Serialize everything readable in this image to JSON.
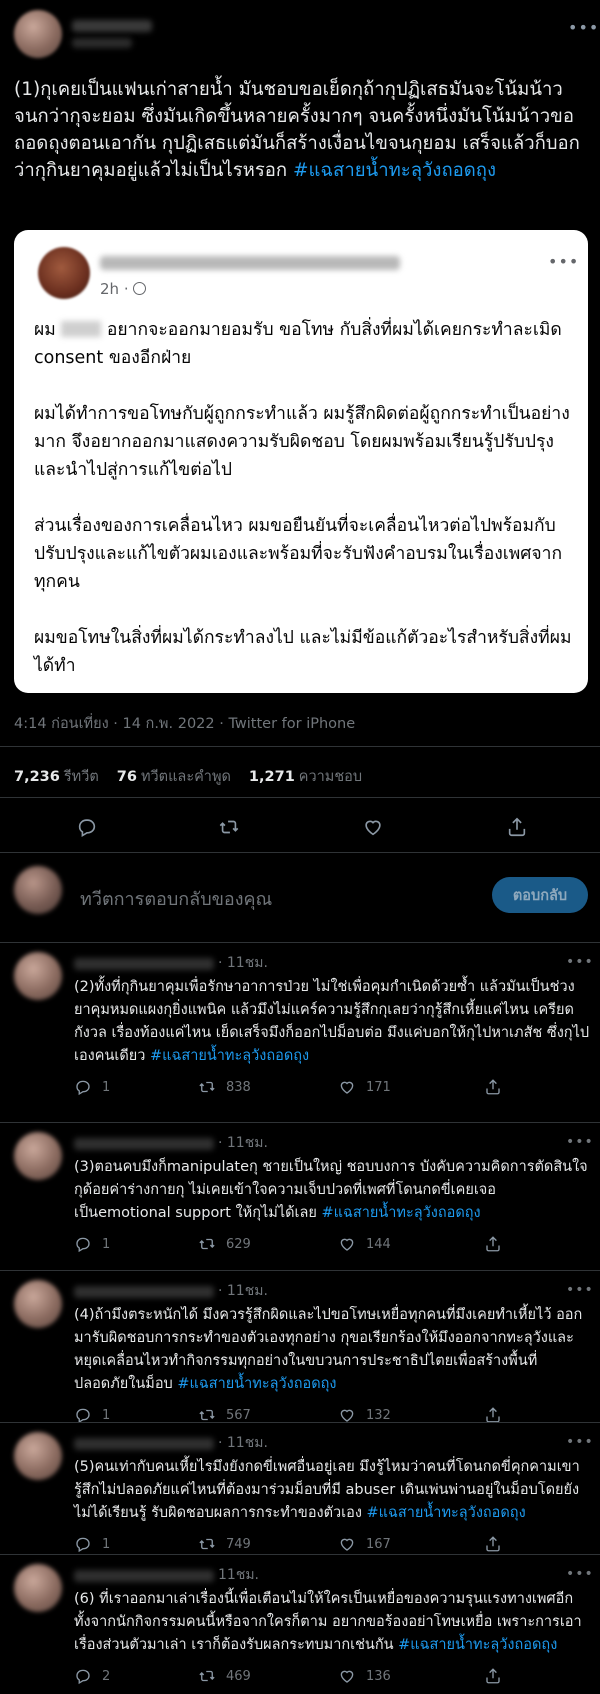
{
  "main_tweet": {
    "text": "(1)กุเคยเป็นแฟนเก่าสายน้ำ มันชอบขอเย็ดกุถ้ากุปฏิเสธมันจะโน้มน้าวจนกว่ากุจะยอม ซึ่งมันเกิดขึ้นหลายครั้งมากๆ จนครั้งหนึ่งมันโน้มน้าวขอถอดถุงตอนเอากัน กุปฏิเสธแต่มันก็สร้างเงื่อนไขจนกุยอม เสร็จแล้วก็บอกว่ากุกินยาคุมอยู่แล้วไม่เป็นไรหรอก ",
    "hashtag": "#แฉสายน้ำทะลุวังถอดถุง",
    "quote": {
      "time": "2h ·",
      "para1_a": "ผม ",
      "para1_b": " อยากจะออกมายอมรับ ขอโทษ กับสิ่งที่ผมได้เคยกระทำละเมิด consent ของอีกฝ่าย",
      "para2": "ผมได้ทำการขอโทษกับผู้ถูกกระทำแล้ว ผมรู้สึกผิดต่อผู้ถูกกระทำเป็นอย่างมาก จึงอยากออกมาแสดงความรับผิดชอบ โดยผมพร้อมเรียนรู้ปรับปรุง และนำไปสู่การแก้ไขต่อไป",
      "para3": "ส่วนเรื่องของการเคลื่อนไหว ผมขอยืนยันที่จะเคลื่อนไหวต่อไปพร้อมกับปรับปรุงและแก้ไขตัวผมเองและพร้อมที่จะรับฟังคำอบรมในเรื่องเพศจากทุกคน",
      "para4": "ผมขอโทษในสิ่งที่ผมได้กระทำลงไป และไม่มีข้อแก้ตัวอะไรสำหรับสิ่งที่ผมได้ทำ"
    },
    "meta": "4:14 ก่อนเที่ยง · 14 ก.พ. 2022 · Twitter for iPhone",
    "stats": {
      "retweets_count": "7,236",
      "retweets_label": "รีทวีต",
      "quotes_count": "76",
      "quotes_label": "ทวีตและคำพูด",
      "likes_count": "1,271",
      "likes_label": "ความชอบ"
    }
  },
  "reply_compose": {
    "placeholder": "ทวีตการตอบกลับของคุณ",
    "button_label": "ตอบกลับ"
  },
  "replies": [
    {
      "time": "· 11ชม.",
      "text": "(2)ทั้งที่กุกินยาคุมเพื่อรักษาอาการป่วย ไม่ใช่เพื่อคุมกำเนิดด้วยซ้ำ แล้วมันเป็นช่วงยาคุมหมดแผงกุยิ่งแพนิค แล้วมึงไม่แคร์ความรู้สึกกุเลยว่ากุรู้สึกเหี้ยแค่ไหน เครียด กังวล เรื่องท้องแค่ไหน เย็ดเสร็จมึงก็ออกไปม็อบต่อ มึงแค่บอกให้กุไปหาเภสัช ซึ่งกุไปเองคนเดียว ",
      "hashtag": "#แฉสายน้ำทะลุวังถอดถุง",
      "replies": "1",
      "retweets": "838",
      "likes": "171"
    },
    {
      "time": "· 11ชม.",
      "text": "(3)ตอนคบมึงก็manipulateกุ ชายเป็นใหญ่ ชอบบงการ บังคับความคิดการตัดสินใจกุด้อยค่าร่างกายกุ ไม่เคยเข้าใจความเจ็บปวดที่เพศที่โดนกดขี่เคยเจอ เป็นemotional support ให้กุไม่ได้เลย ",
      "hashtag": "#แฉสายน้ำทะลุวังถอดถุง",
      "replies": "1",
      "retweets": "629",
      "likes": "144"
    },
    {
      "time": "· 11ชม.",
      "text": "(4)ถ้ามึงตระหนักได้ มึงควรรู้สึกผิดและไปขอโทษเหยื่อทุกคนที่มึงเคยทำเหี้ยไว้ ออกมารับผิดชอบการกระทำของตัวเองทุกอย่าง กุขอเรียกร้องให้มึงออกจากทะลุวังและหยุดเคลื่อนไหวทำกิจกรรมทุกอย่างในขบวนการประชาธิปไตยเพื่อสร้างพื้นที่ปลอดภัยในม็อบ ",
      "hashtag": "#แฉสายน้ำทะลุวังถอดถุง",
      "replies": "1",
      "retweets": "567",
      "likes": "132"
    },
    {
      "time": "· 11ชม.",
      "text": "(5)คนเท่ากับคนเหี้ยไรมึงยังกดขี่เพศอื่นอยู่เลย มึงรู้ไหมว่าคนที่โดนกดขี่คุกคามเขารู้สึกไม่ปลอดภัยแค่ไหนที่ต้องมาร่วมม็อบที่มี abuser เดินเพ่นพ่านอยู่ในม็อบโดยยังไม่ได้เรียนรู้ รับผิดชอบผลการกระทำของตัวเอง ",
      "hashtag": "#แฉสายน้ำทะลุวังถอดถุง",
      "replies": "1",
      "retweets": "749",
      "likes": "167"
    },
    {
      "time": "11ชม.",
      "text": "(6) ที่เราออกมาเล่าเรื่องนี้เพื่อเตือนไม่ให้ใครเป็นเหยื่อของความรุนแรงทางเพศอีก ทั้งจากนักกิจกรรมคนนี้หรือจากใครก็ตาม อยากขอร้องอย่าโทษเหยื่อ เพราะการเอาเรื่องส่วนตัวมาเล่า เราก็ต้องรับผลกระทบมากเช่นกัน ",
      "hashtag": "#แฉสายน้ำทะลุวังถอดถุง",
      "replies": "2",
      "retweets": "469",
      "likes": "136"
    }
  ],
  "icons": {
    "more": "more-horizontal-icon",
    "reply": "reply-icon",
    "retweet": "retweet-icon",
    "like": "heart-icon",
    "share": "share-icon",
    "globe": "globe-icon"
  },
  "colors": {
    "background": "#000000",
    "link": "#1d9bf0",
    "muted": "#71767b",
    "button": "#1a5a88"
  }
}
